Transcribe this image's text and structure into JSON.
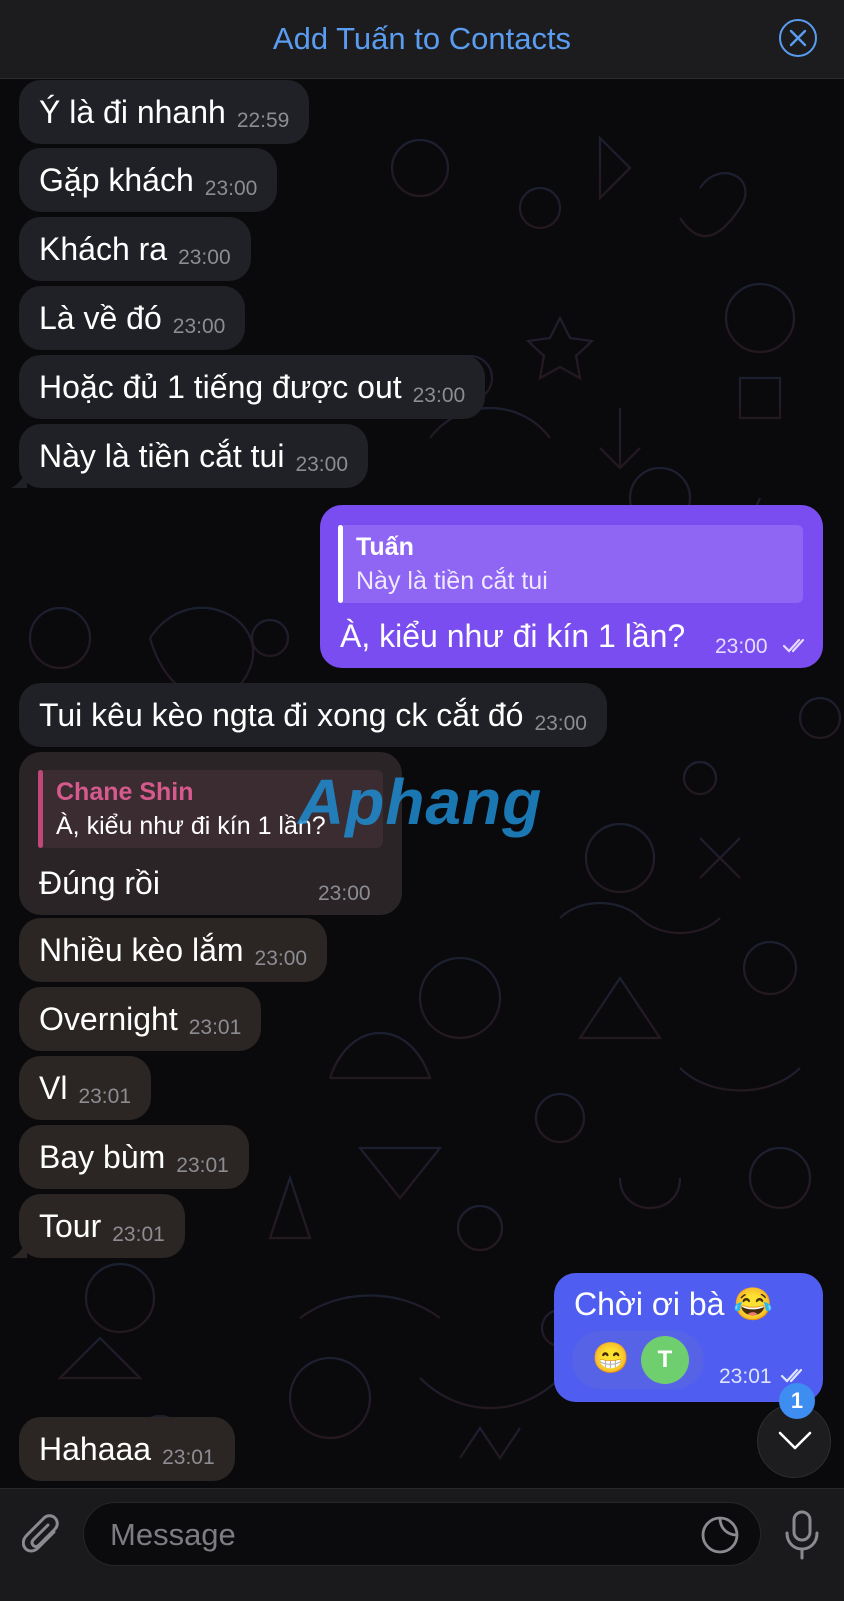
{
  "banner": {
    "title": "Add Tuấn to Contacts"
  },
  "messages": {
    "m1": {
      "text": "Ý là đi nhanh",
      "time": "22:59"
    },
    "m2": {
      "text": "Gặp khách",
      "time": "23:00"
    },
    "m3": {
      "text": "Khách ra",
      "time": "23:00"
    },
    "m4": {
      "text": "Là về đó",
      "time": "23:00"
    },
    "m5": {
      "text": "Hoặc đủ 1 tiếng được out",
      "time": "23:00"
    },
    "m6": {
      "text": "Này là tiền cắt tui",
      "time": "23:00"
    },
    "o1": {
      "reply_name": "Tuấn",
      "reply_text": "Này là tiền cắt tui",
      "text": "À, kiểu như đi kín 1 lần?",
      "time": "23:00"
    },
    "m7": {
      "text": "Tui kêu kèo ngta đi xong ck cắt đó",
      "time": "23:00"
    },
    "m8": {
      "reply_name": "Chane Shin",
      "reply_text": "À, kiểu như đi kín 1 lần?",
      "text": "Đúng rồi",
      "time": "23:00"
    },
    "m9": {
      "text": "Nhiều kèo lắm",
      "time": "23:00"
    },
    "m10": {
      "text": "Overnight",
      "time": "23:01"
    },
    "m11": {
      "text": "Vl",
      "time": "23:01"
    },
    "m12": {
      "text": "Bay bùm",
      "time": "23:01"
    },
    "m13": {
      "text": "Tour",
      "time": "23:01"
    },
    "o2": {
      "text": "Chời ơi bà 😂",
      "time": "23:01",
      "reaction_emoji": "😁",
      "reaction_avatar_letter": "T"
    },
    "m14": {
      "text": "Hahaaa",
      "time": "23:01"
    }
  },
  "watermark": {
    "text": "Aphang"
  },
  "scroll_badge": {
    "count": "1"
  },
  "composer": {
    "placeholder": "Message"
  },
  "colors": {
    "accent": "#5a9cf0",
    "outgoing_bubble_top": "#7a4df0",
    "outgoing_bubble_bottom": "#5663e6",
    "incoming_bubble": "#1f2126",
    "reply_name_sender": "#c0477a"
  },
  "icons": {
    "close": "close-circle-icon",
    "read_status": "double-check-icon",
    "attach": "paperclip-icon",
    "sticker": "sticker-icon",
    "mic": "microphone-icon",
    "scroll_down": "chevron-down-icon"
  }
}
